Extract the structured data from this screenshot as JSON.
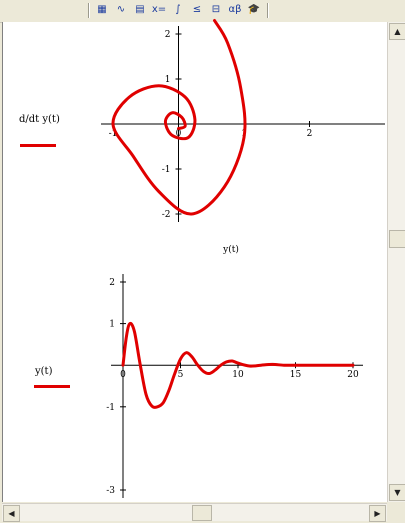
{
  "toolbar": {
    "items": [
      {
        "name": "calculator-icon",
        "glyph": "▦"
      },
      {
        "name": "graph-icon",
        "glyph": "∿"
      },
      {
        "name": "matrix-icon",
        "glyph": "▤"
      },
      {
        "name": "evaluation-icon",
        "glyph": "x="
      },
      {
        "name": "calculus-icon",
        "glyph": "∫"
      },
      {
        "name": "boolean-icon",
        "glyph": "≤"
      },
      {
        "name": "programming-icon",
        "glyph": "⊟"
      },
      {
        "name": "greek-icon",
        "glyph": "αβ"
      },
      {
        "name": "symbolic-icon",
        "glyph": "🎓"
      }
    ]
  },
  "chart_data": [
    {
      "type": "line",
      "xlabel": "y(t)",
      "legend": {
        "label": "d/dt y(t)",
        "color": "#e00000"
      },
      "xlim": [
        -1,
        3
      ],
      "ylim": [
        -2,
        2
      ],
      "x_ticks": [
        "-1",
        "0",
        "1",
        "2"
      ],
      "y_ticks": [
        "2",
        "1",
        "-1",
        "-2"
      ],
      "x_tick_values": [
        -1,
        0,
        1,
        2
      ],
      "y_tick_values": [
        2,
        1,
        -1,
        -2
      ],
      "series": [
        {
          "color": "#e00000",
          "x": [
            0.55,
            0.75,
            0.95,
            1.0,
            0.7,
            0.2,
            -0.3,
            -0.7,
            -1.0,
            -0.75,
            -0.3,
            0.1,
            0.25,
            0.15,
            -0.1,
            -0.2,
            -0.1,
            0.05,
            0.1,
            0.0
          ],
          "y": [
            2.3,
            1.8,
            0.8,
            -0.3,
            -1.4,
            -2.0,
            -1.5,
            -0.7,
            0.0,
            0.6,
            0.85,
            0.6,
            0.1,
            -0.3,
            -0.25,
            0.05,
            0.25,
            0.15,
            -0.05,
            -0.1
          ]
        }
      ]
    },
    {
      "type": "line",
      "xlabel": "",
      "legend": {
        "label": "y(t)",
        "color": "#e00000"
      },
      "xlim": [
        0,
        20
      ],
      "ylim": [
        -3,
        2
      ],
      "x_ticks": [
        "0",
        "5",
        "10",
        "15",
        "20"
      ],
      "y_ticks": [
        "2",
        "1",
        "-1",
        "-3"
      ],
      "x_tick_values": [
        0,
        5,
        10,
        15,
        20
      ],
      "y_tick_values": [
        2,
        1,
        -1,
        -3
      ],
      "series": [
        {
          "color": "#e00000",
          "x": [
            0,
            0.3,
            0.6,
            1,
            1.5,
            2,
            2.5,
            3,
            3.5,
            4,
            4.5,
            5,
            5.5,
            6,
            6.5,
            7,
            7.5,
            8,
            8.5,
            9,
            9.5,
            10,
            11,
            12,
            13,
            14,
            15,
            16,
            17,
            18,
            19,
            20
          ],
          "y": [
            0,
            0.7,
            1.0,
            0.8,
            0.0,
            -0.7,
            -0.98,
            -1.0,
            -0.9,
            -0.6,
            -0.2,
            0.15,
            0.3,
            0.2,
            0.0,
            -0.15,
            -0.2,
            -0.12,
            0.0,
            0.08,
            0.1,
            0.05,
            -0.02,
            0.0,
            0.02,
            0.0,
            0.0,
            0.0,
            0.0,
            0.0,
            0.0,
            0.0
          ]
        }
      ]
    }
  ]
}
